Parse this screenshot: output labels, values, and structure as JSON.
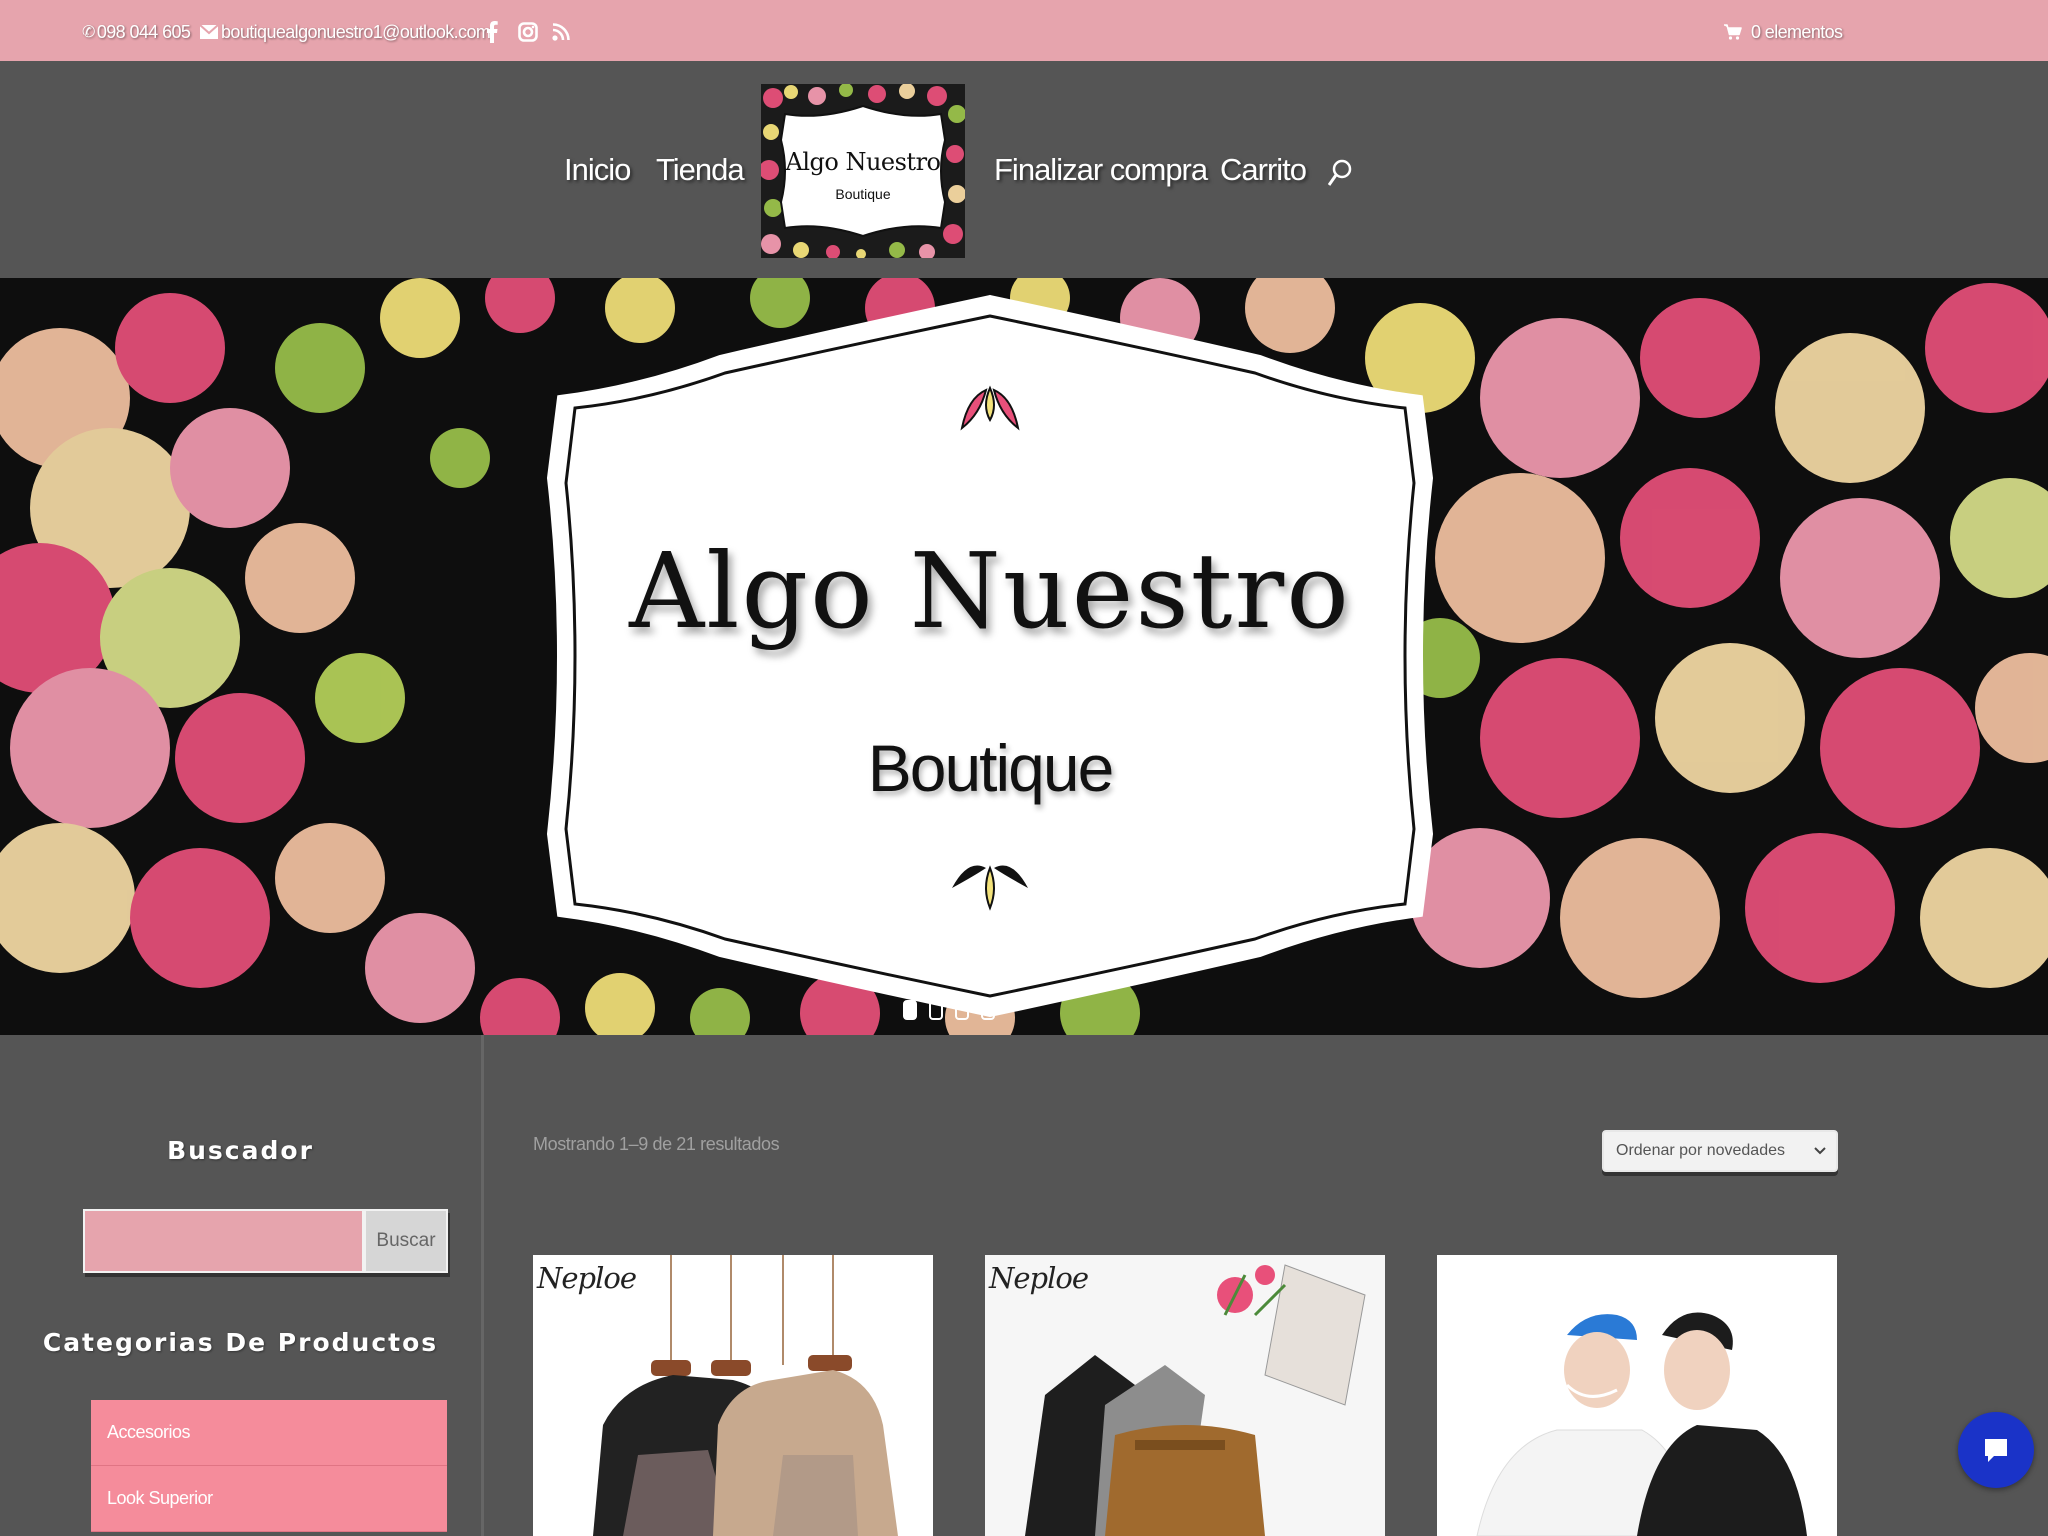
{
  "topbar": {
    "phone": "098 044 605",
    "email": "boutiquealgonuestro1@outlook.com",
    "cart": "0 elementos",
    "social_icons": [
      "facebook-icon",
      "instagram-icon",
      "rss-icon"
    ]
  },
  "nav": {
    "items": [
      {
        "label": "Inicio"
      },
      {
        "label": "Tienda"
      },
      {
        "label": "Finalizar compra"
      },
      {
        "label": "Carrito"
      }
    ]
  },
  "logo": {
    "line1": "Algo Nuestro",
    "line2": "Boutique"
  },
  "hero": {
    "title": "Algo Nuestro",
    "subtitle": "Boutique",
    "slides": 4,
    "active_slide": 1
  },
  "sidebar": {
    "search_title": "Buscador",
    "search_button": "Buscar",
    "search_placeholder": "",
    "categories_title": "Categorias De Productos",
    "categories": [
      {
        "label": "Accesorios"
      },
      {
        "label": "Look Superior"
      }
    ]
  },
  "main": {
    "results_text": "Mostrando 1–9 de 21 resultados",
    "order_selected": "Ordenar por novedades",
    "products": [
      {
        "brand": "Neploe"
      },
      {
        "brand": "Neploe"
      },
      {
        "brand": ""
      }
    ]
  },
  "colors": {
    "topbar": "#e6a4ad",
    "background": "#555555",
    "category_bg": "#f58c9b",
    "chat_button": "#1a33c8"
  }
}
